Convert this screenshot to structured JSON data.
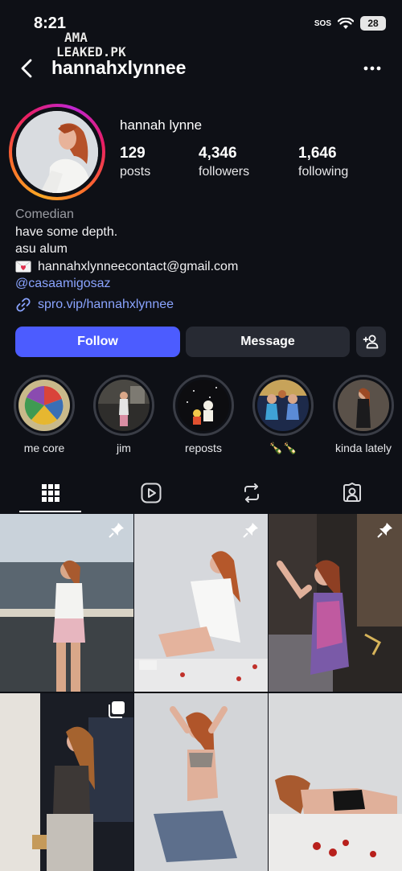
{
  "status_bar": {
    "time": "8:21",
    "sos": "SOS",
    "battery": "28"
  },
  "watermark": {
    "line1": "AMA",
    "line2": "LEAKED.PK"
  },
  "header": {
    "username": "hannahxlynnee"
  },
  "profile": {
    "display_name": "hannah lynne",
    "stats": [
      {
        "value": "129",
        "label": "posts"
      },
      {
        "value": "4,346",
        "label": "followers"
      },
      {
        "value": "1,646",
        "label": "following"
      }
    ],
    "bio": {
      "category": "Comedian",
      "line1": "have some depth.",
      "line2": "asu alum",
      "email": "hannahxlynneecontact@gmail.com",
      "mention": "@casaamigosaz",
      "link": "spro.vip/hannahxlynnee"
    }
  },
  "actions": {
    "follow": "Follow",
    "message": "Message"
  },
  "highlights": [
    {
      "label": "me core"
    },
    {
      "label": "jim"
    },
    {
      "label": "reposts"
    },
    {
      "label": "🍾🍾"
    },
    {
      "label": "kinda lately"
    }
  ],
  "tabs": [
    "posts-grid-icon",
    "reels-icon",
    "reposts-icon",
    "tagged-icon"
  ],
  "colors": {
    "accent": "#4c5cff",
    "link": "#8aa4ff",
    "background": "#0e1016",
    "secondary_button": "#272a33"
  }
}
